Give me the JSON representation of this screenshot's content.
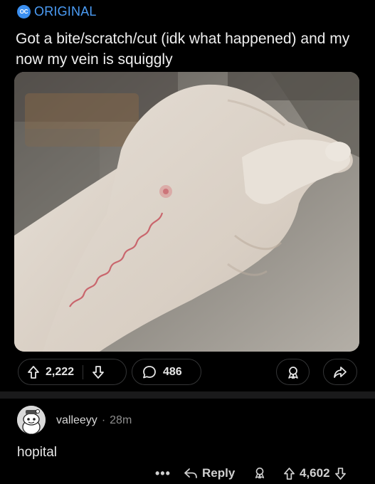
{
  "post": {
    "badge_short": "OC",
    "badge_label": "ORIGINAL",
    "title": "Got a bite/scratch/cut (idk what happened) and my now my vein is squiggly",
    "image_icon": "photo-of-hand-with-squiggly-red-line"
  },
  "actions": {
    "upvotes": "2,222",
    "comments": "486",
    "upvote_icon": "arrow-up-icon",
    "downvote_icon": "arrow-down-icon",
    "comment_icon": "speech-bubble-icon",
    "award_icon": "award-icon",
    "share_icon": "share-arrow-icon"
  },
  "comment": {
    "username": "valleeyy",
    "separator": "·",
    "age": "28m",
    "body": "hopital",
    "more": "•••",
    "reply_label": "Reply",
    "votes": "4,602"
  },
  "colors": {
    "accent": "#4b9cf5",
    "background": "#000000",
    "divider": "#1a1a1b"
  }
}
